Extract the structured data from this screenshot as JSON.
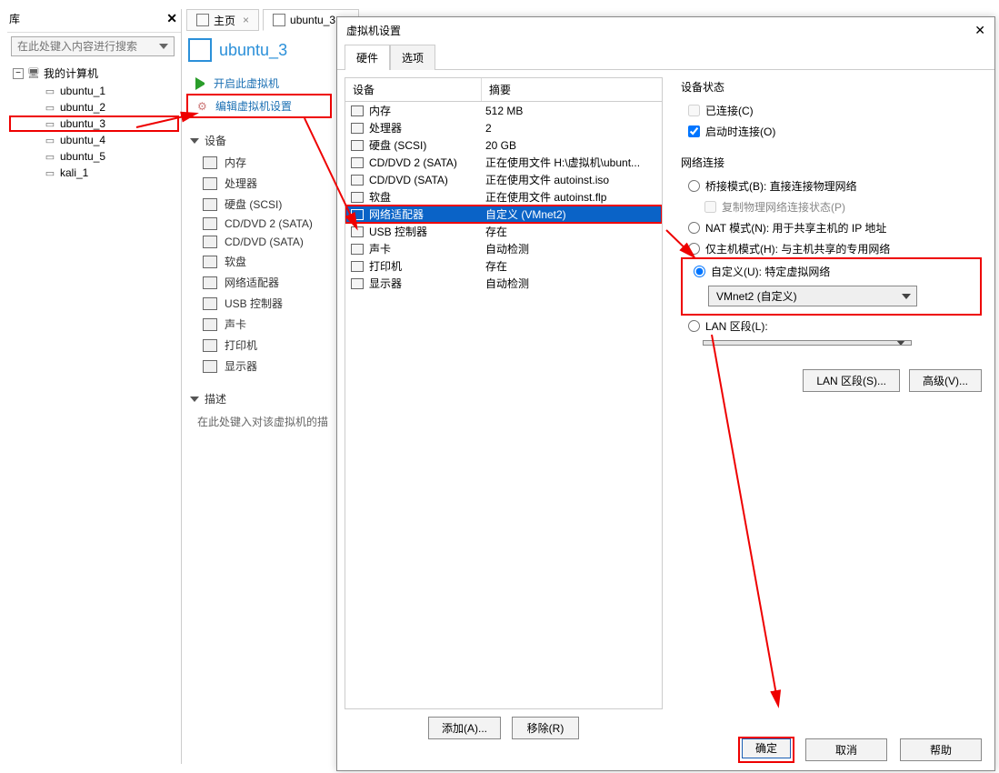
{
  "library": {
    "title": "库",
    "search_placeholder": "在此处键入内容进行搜索",
    "root": "我的计算机",
    "items": [
      "ubuntu_1",
      "ubuntu_2",
      "ubuntu_3",
      "ubuntu_4",
      "ubuntu_5",
      "kali_1"
    ]
  },
  "tabs": {
    "home": "主页",
    "active": "ubuntu_3"
  },
  "vm": {
    "title": "ubuntu_3",
    "start": "开启此虚拟机",
    "edit_settings": "编辑虚拟机设置",
    "devices_header": "设备",
    "devices": [
      "内存",
      "处理器",
      "硬盘 (SCSI)",
      "CD/DVD 2 (SATA)",
      "CD/DVD (SATA)",
      "软盘",
      "网络适配器",
      "USB 控制器",
      "声卡",
      "打印机",
      "显示器"
    ],
    "desc_header": "描述",
    "desc_hint": "在此处键入对该虚拟机的描"
  },
  "dialog": {
    "title": "虚拟机设置",
    "tab_hw": "硬件",
    "tab_opt": "选项",
    "th_device": "设备",
    "th_summary": "摘要",
    "rows": [
      {
        "name": "内存",
        "summary": "512 MB"
      },
      {
        "name": "处理器",
        "summary": "2"
      },
      {
        "name": "硬盘 (SCSI)",
        "summary": "20 GB"
      },
      {
        "name": "CD/DVD 2 (SATA)",
        "summary": "正在使用文件 H:\\虚拟机\\ubunt..."
      },
      {
        "name": "CD/DVD (SATA)",
        "summary": "正在使用文件 autoinst.iso"
      },
      {
        "name": "软盘",
        "summary": "正在使用文件 autoinst.flp"
      },
      {
        "name": "网络适配器",
        "summary": "自定义 (VMnet2)"
      },
      {
        "name": "USB 控制器",
        "summary": "存在"
      },
      {
        "name": "声卡",
        "summary": "自动检测"
      },
      {
        "name": "打印机",
        "summary": "存在"
      },
      {
        "name": "显示器",
        "summary": "自动检测"
      }
    ],
    "add": "添加(A)...",
    "remove": "移除(R)"
  },
  "right": {
    "state_header": "设备状态",
    "connected": "已连接(C)",
    "connect_on": "启动时连接(O)",
    "net_header": "网络连接",
    "bridged": "桥接模式(B): 直接连接物理网络",
    "replicate": "复制物理网络连接状态(P)",
    "nat": "NAT 模式(N): 用于共享主机的 IP 地址",
    "hostonly": "仅主机模式(H): 与主机共享的专用网络",
    "custom": "自定义(U): 特定虚拟网络",
    "custom_value": "VMnet2 (自定义)",
    "lan_seg": "LAN 区段(L):",
    "lan_btn": "LAN 区段(S)...",
    "adv_btn": "高级(V)..."
  },
  "footer": {
    "ok": "确定",
    "cancel": "取消",
    "help": "帮助"
  }
}
